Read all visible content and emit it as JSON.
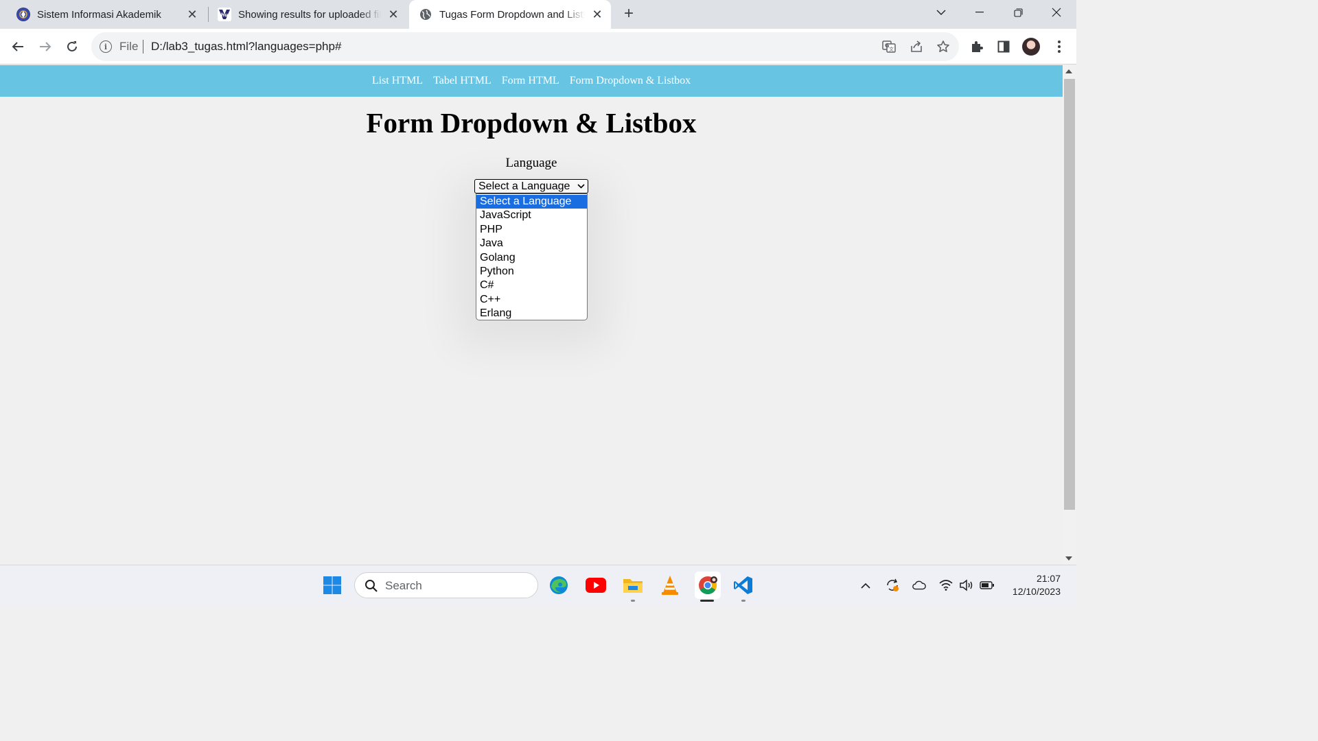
{
  "browser": {
    "tabs": [
      {
        "title": "Sistem Informasi Akademik",
        "favicon": "university-logo-icon",
        "active": false
      },
      {
        "title": "Showing results for uploaded file",
        "favicon": "hu-logo-icon",
        "active": false
      },
      {
        "title": "Tugas Form Dropdown and Listbox",
        "favicon": "globe-icon",
        "active": true
      }
    ],
    "address": {
      "scheme_label": "File",
      "url": "D:/lab3_tugas.html?languages=php#"
    }
  },
  "page": {
    "nav": [
      "List HTML",
      "Tabel HTML",
      "Form HTML",
      "Form Dropdown & Listbox"
    ],
    "title": "Form Dropdown & Listbox",
    "field_label": "Language",
    "select": {
      "selected": "Select a Language",
      "options": [
        "Select a Language",
        "JavaScript",
        "PHP",
        "Java",
        "Golang",
        "Python",
        "C#",
        "C++",
        "Erlang"
      ],
      "highlighted_index": 0
    }
  },
  "taskbar": {
    "search_placeholder": "Search",
    "time": "21:07",
    "date": "12/10/2023"
  },
  "colors": {
    "nav_bg": "#68c4e3",
    "option_highlight": "#1a6ce1",
    "tabstrip_bg": "#dee1e6"
  }
}
